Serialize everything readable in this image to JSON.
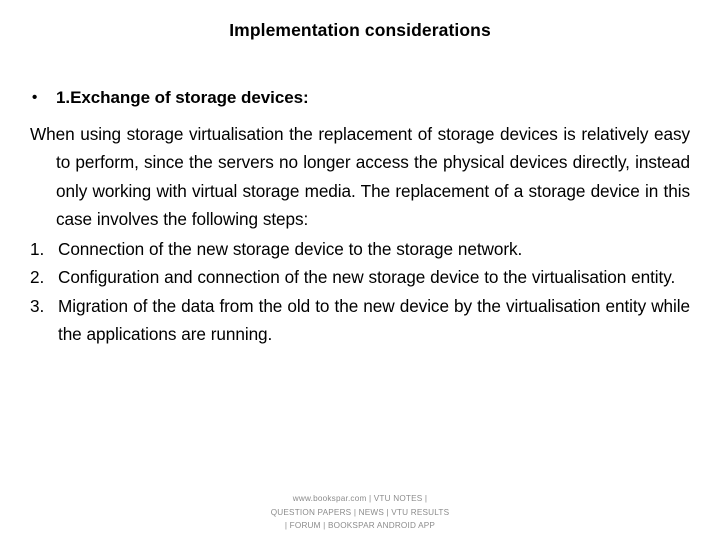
{
  "slide": {
    "title": "Implementation considerations",
    "heading_bullet": {
      "bullet_glyph": "•",
      "text": "1.Exchange of storage devices:"
    },
    "paragraph": "When using storage virtualisation the replacement of storage devices is relatively easy to perform, since the servers no longer access the physical devices directly, instead only working with virtual storage media. The replacement of a storage device in this case involves the following steps:",
    "steps": [
      {
        "number": "1.",
        "text": "Connection of the new storage device to the storage network."
      },
      {
        "number": "2.",
        "text": "Configuration and connection of the new storage device to the virtualisation entity."
      },
      {
        "number": "3.",
        "text": "Migration of the data from the old to the new device by the virtualisation entity while the applications are running."
      }
    ]
  },
  "footer": {
    "line1": "www.bookspar.com | VTU NOTES |",
    "line2": "QUESTION PAPERS | NEWS | VTU RESULTS",
    "line3": "| FORUM | BOOKSPAR ANDROID APP",
    "color": "#8c8c8c"
  }
}
